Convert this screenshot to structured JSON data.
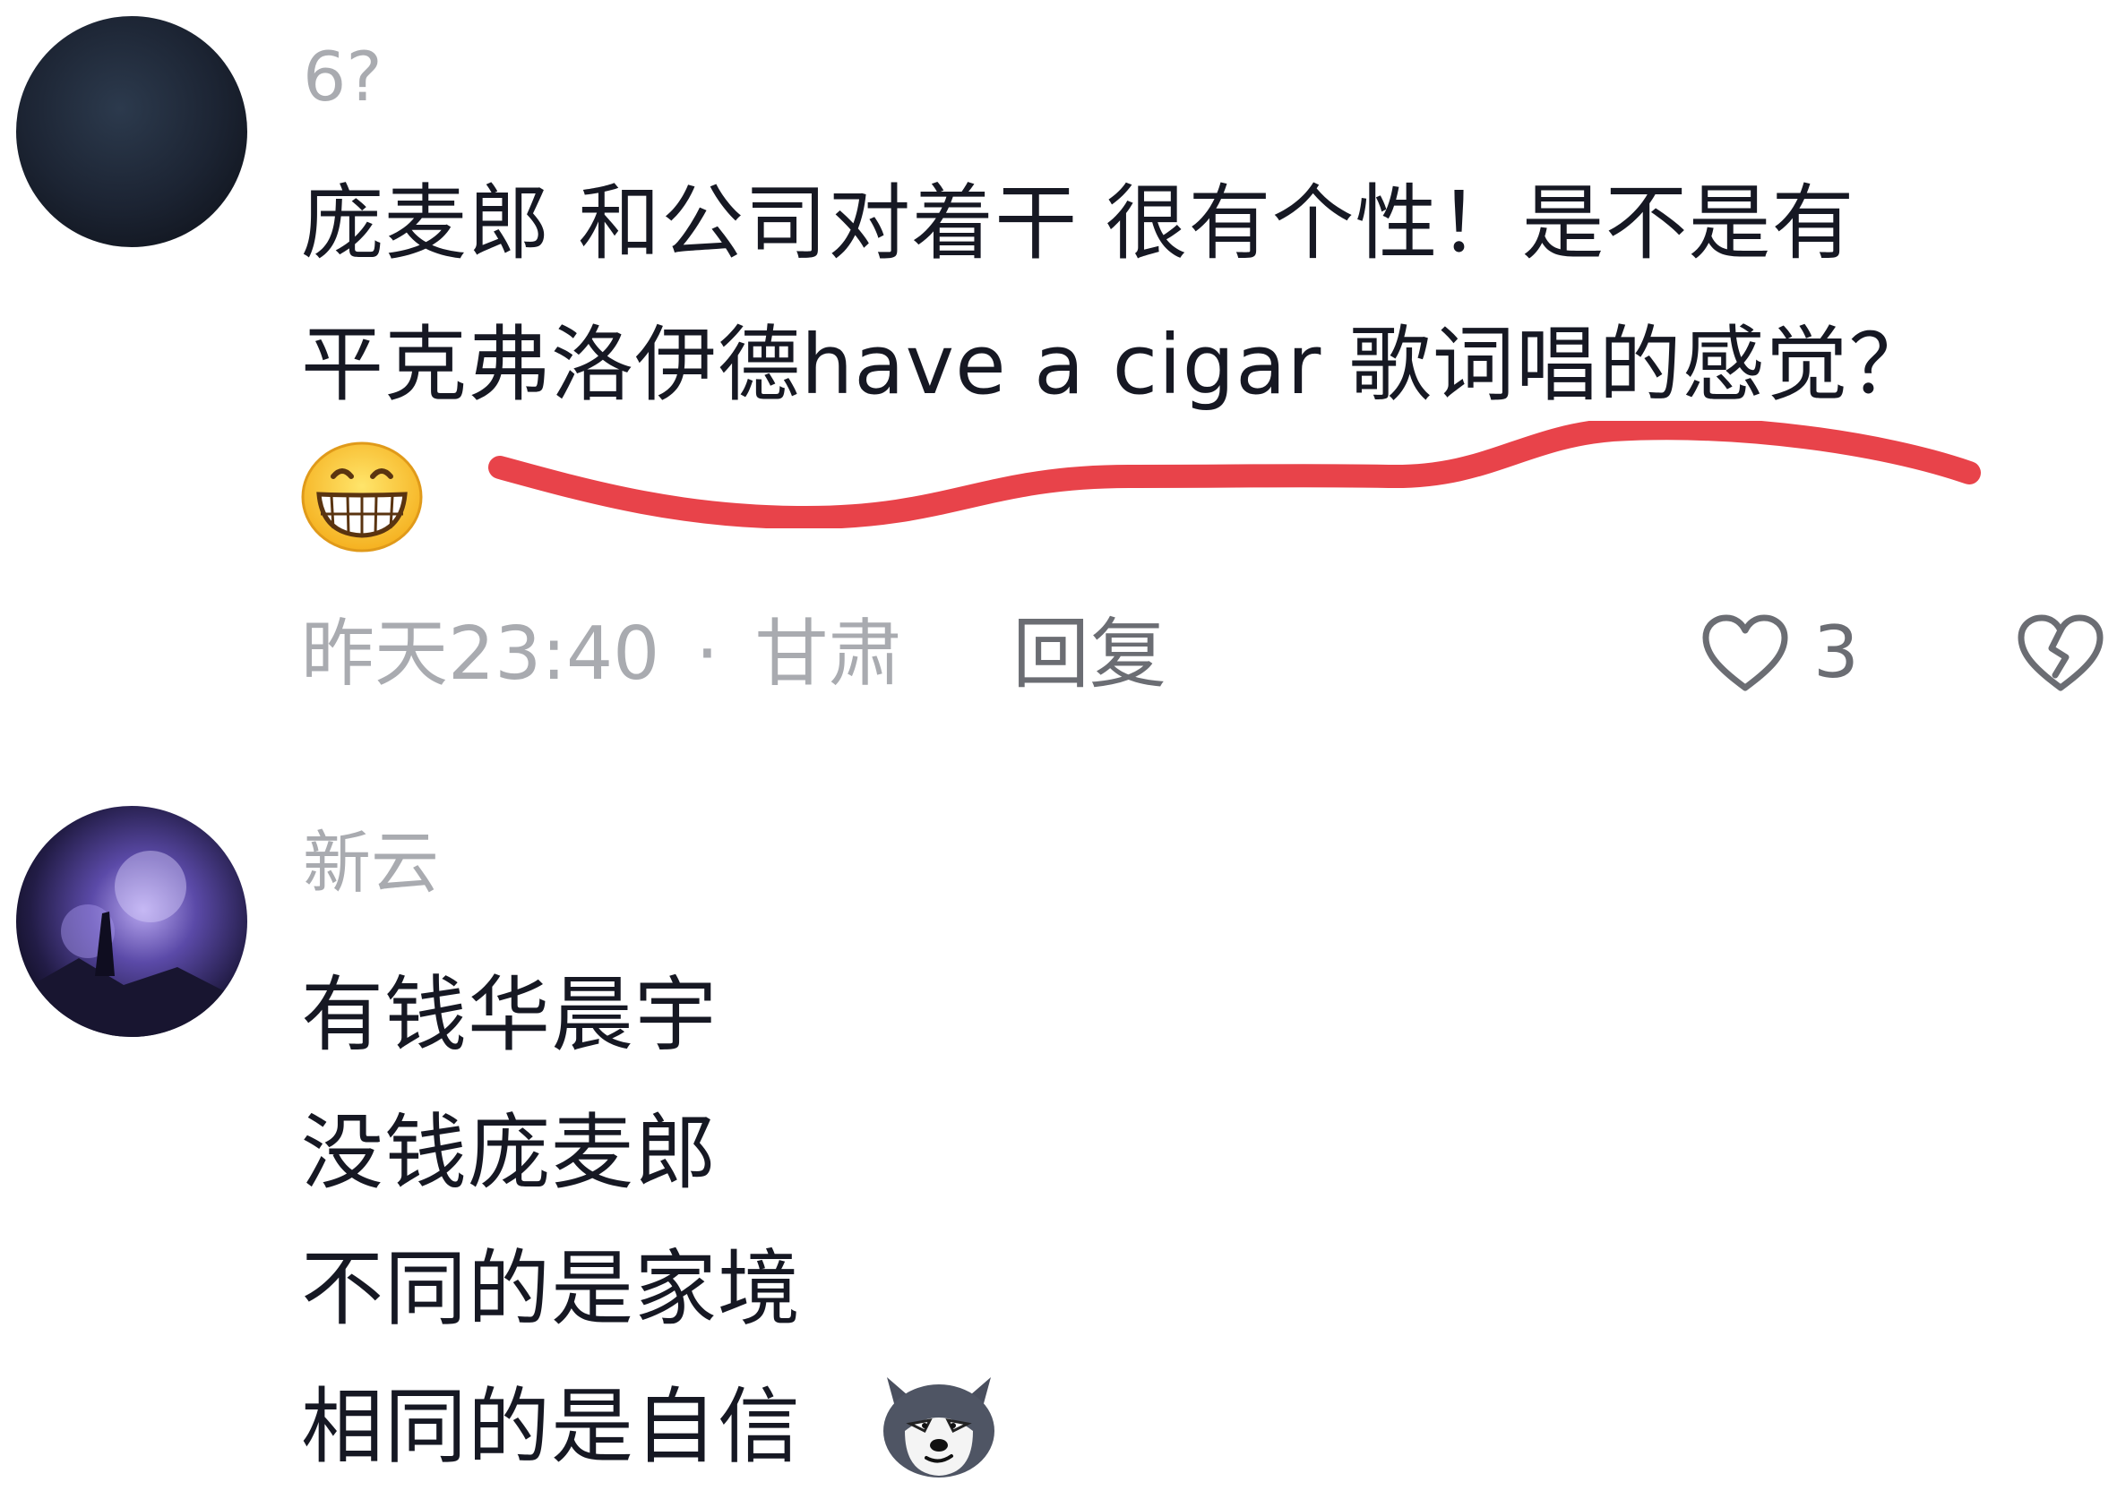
{
  "comments": [
    {
      "username": "6?",
      "lines": [
        "庞麦郎 和公司对着干 很有个性！是不是有",
        "平克弗洛伊德have a cigar 歌词唱的感觉？"
      ],
      "emoji": "grinning-face-emoji",
      "timestamp": "昨天23:40",
      "location": "甘肃",
      "separator": "·",
      "reply_label": "回复",
      "like_count": "3",
      "annotation_color": "#e8434a"
    },
    {
      "username": "新云",
      "lines": [
        "有钱华晨宇",
        "没钱庞麦郎",
        "不同的是家境",
        "相同的是自信"
      ],
      "emoji": "husky-dog-face-emoji"
    }
  ],
  "colors": {
    "text": "#161823",
    "meta": "#a9abb0",
    "action": "#6b6d73",
    "annotation": "#e8434a"
  }
}
